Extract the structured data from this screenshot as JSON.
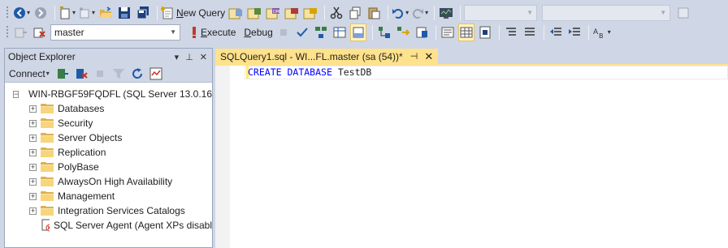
{
  "toolbar1": {
    "new_query_label": "New Query",
    "combo1": "",
    "combo2": ""
  },
  "toolbar2": {
    "database": "master",
    "execute_label": "Execute",
    "debug_label": "Debug"
  },
  "object_explorer": {
    "title": "Object Explorer",
    "connect_label": "Connect",
    "server": "WIN-RBGF59FQDFL (SQL Server 13.0.16",
    "nodes": [
      "Databases",
      "Security",
      "Server Objects",
      "Replication",
      "PolyBase",
      "AlwaysOn High Availability",
      "Management",
      "Integration Services Catalogs"
    ],
    "agent": "SQL Server Agent (Agent XPs disabl"
  },
  "editor": {
    "tab_title": "SQLQuery1.sql - WI...FL.master (sa (54))*",
    "code_kw1": "CREATE",
    "code_kw2": "DATABASE",
    "code_ident": "TestDB"
  },
  "colors": {
    "chrome": "#cfd6e5",
    "active_tab": "#ffe28c",
    "keyword": "#0000ff"
  }
}
